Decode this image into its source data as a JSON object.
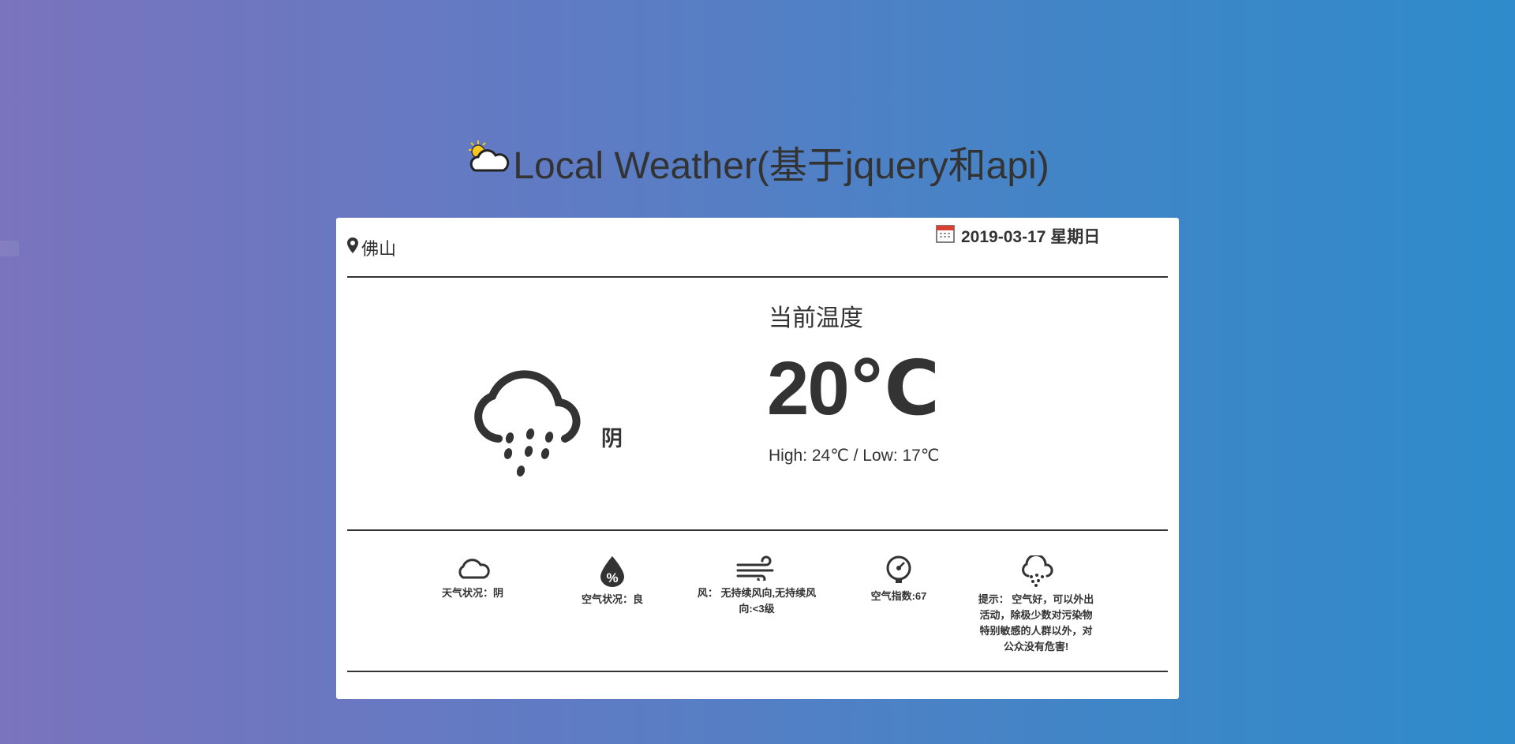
{
  "header": {
    "title": "Local Weather(基于jquery和api)",
    "title_icon": "sun-behind-cloud-icon"
  },
  "card": {
    "location": "佛山",
    "date": "2019-03-17 星期日",
    "condition": "阴",
    "current_label": "当前温度",
    "current_temp": "20℃",
    "high_low": "High: 24℃ / Low: 17℃"
  },
  "details": [
    {
      "icon": "cloud-icon",
      "text": "天气状况：阴"
    },
    {
      "icon": "humidity-drop-icon",
      "text": "空气状况：良"
    },
    {
      "icon": "wind-icon",
      "text": "风：   无持续风向,无持续风向:<3级"
    },
    {
      "icon": "gauge-icon",
      "text": "空气指数:67"
    },
    {
      "icon": "rain-cloud-icon",
      "text": "提示：  空气好，可以外出活动，除极少数对污染物特别敏感的人群以外，对公众没有危害!"
    }
  ],
  "colors": {
    "text": "#333333",
    "card_bg": "#ffffff",
    "gradient_start": "#7a73bd",
    "gradient_end": "#2f8bcb",
    "sun_yellow": "#f7c81e"
  }
}
